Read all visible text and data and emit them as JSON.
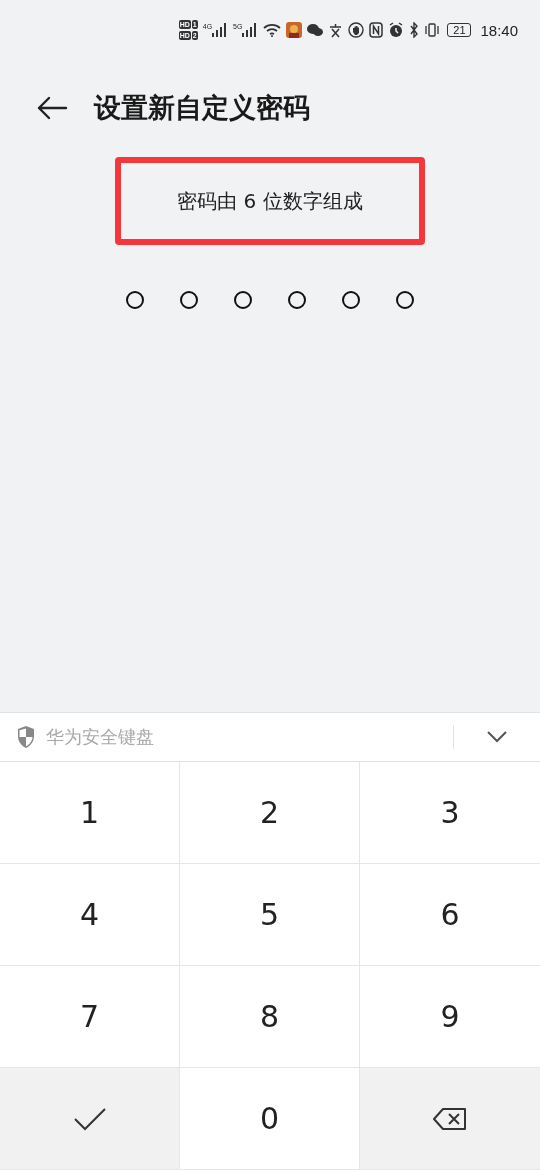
{
  "status_bar": {
    "sim_badges": [
      "HD",
      "1",
      "HD",
      "2"
    ],
    "networks": [
      "4G",
      "5G"
    ],
    "battery": "21",
    "time": "18:40"
  },
  "header": {
    "title": "设置新自定义密码"
  },
  "hint": {
    "text": "密码由 6 位数字组成",
    "highlighted": true
  },
  "pin_dots": [
    {
      "filled": false
    },
    {
      "filled": false
    },
    {
      "filled": false
    },
    {
      "filled": false
    },
    {
      "filled": false
    },
    {
      "filled": false
    }
  ],
  "keyboard": {
    "title": "华为安全键盘",
    "keys": [
      {
        "kind": "digit",
        "label": "1"
      },
      {
        "kind": "digit",
        "label": "2"
      },
      {
        "kind": "digit",
        "label": "3"
      },
      {
        "kind": "digit",
        "label": "4"
      },
      {
        "kind": "digit",
        "label": "5"
      },
      {
        "kind": "digit",
        "label": "6"
      },
      {
        "kind": "digit",
        "label": "7"
      },
      {
        "kind": "digit",
        "label": "8"
      },
      {
        "kind": "digit",
        "label": "9"
      },
      {
        "kind": "confirm"
      },
      {
        "kind": "digit",
        "label": "0"
      },
      {
        "kind": "delete"
      }
    ]
  }
}
